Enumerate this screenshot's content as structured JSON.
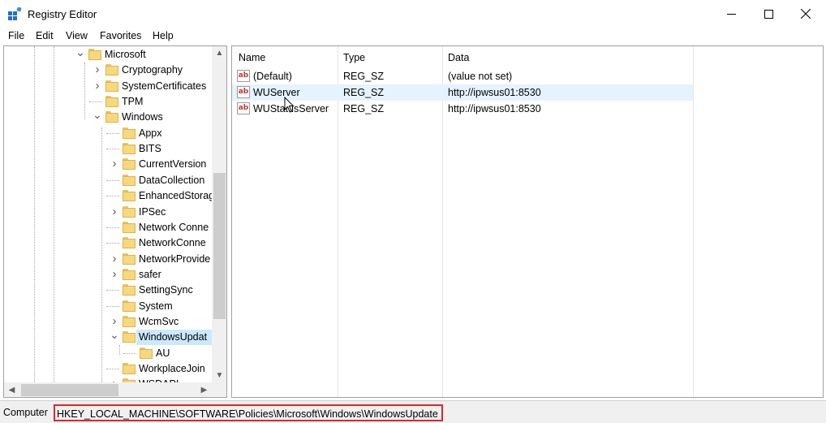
{
  "window": {
    "title": "Registry Editor",
    "icon": "registry-editor-icon"
  },
  "menu": [
    "File",
    "Edit",
    "View",
    "Favorites",
    "Help"
  ],
  "tree": [
    {
      "label": "Microsoft",
      "expanded": true,
      "depth": 0
    },
    {
      "label": "Cryptography",
      "expandable": true,
      "depth": 1
    },
    {
      "label": "SystemCertificates",
      "expandable": true,
      "depth": 1
    },
    {
      "label": "TPM",
      "expandable": false,
      "depth": 1
    },
    {
      "label": "Windows",
      "expanded": true,
      "depth": 1
    },
    {
      "label": "Appx",
      "expandable": false,
      "depth": 2
    },
    {
      "label": "BITS",
      "expandable": false,
      "depth": 2
    },
    {
      "label": "CurrentVersion",
      "expandable": true,
      "depth": 2
    },
    {
      "label": "DataCollection",
      "expandable": false,
      "depth": 2
    },
    {
      "label": "EnhancedStorag",
      "expandable": false,
      "depth": 2
    },
    {
      "label": "IPSec",
      "expandable": true,
      "depth": 2
    },
    {
      "label": "Network Conne",
      "expandable": false,
      "depth": 2
    },
    {
      "label": "NetworkConne",
      "expandable": false,
      "depth": 2
    },
    {
      "label": "NetworkProvide",
      "expandable": true,
      "depth": 2
    },
    {
      "label": "safer",
      "expandable": true,
      "depth": 2
    },
    {
      "label": "SettingSync",
      "expandable": false,
      "depth": 2
    },
    {
      "label": "System",
      "expandable": false,
      "depth": 2
    },
    {
      "label": "WcmSvc",
      "expandable": true,
      "depth": 2
    },
    {
      "label": "WindowsUpdat",
      "expanded": true,
      "selected": true,
      "depth": 2
    },
    {
      "label": "AU",
      "expandable": false,
      "depth": 3
    },
    {
      "label": "WorkplaceJoin",
      "expandable": false,
      "depth": 2
    },
    {
      "label": "WSDAPI",
      "expandable": true,
      "depth": 2
    }
  ],
  "columns": [
    "Name",
    "Type",
    "Data"
  ],
  "values": [
    {
      "name": "(Default)",
      "type": "REG_SZ",
      "data": "(value not set)"
    },
    {
      "name": "WUServer",
      "type": "REG_SZ",
      "data": "http://ipwsus01:8530",
      "hover": true
    },
    {
      "name": "WUStatusServer",
      "type": "REG_SZ",
      "data": "http://ipwsus01:8530"
    }
  ],
  "status": {
    "label": "Computer",
    "path": "HKEY_LOCAL_MACHINE\\SOFTWARE\\Policies\\Microsoft\\Windows\\WindowsUpdate"
  },
  "colors": {
    "selection": "#cce8ff",
    "hover": "#e5f3ff",
    "highlight_box": "#e0262b",
    "folder": "#f7d87c"
  }
}
